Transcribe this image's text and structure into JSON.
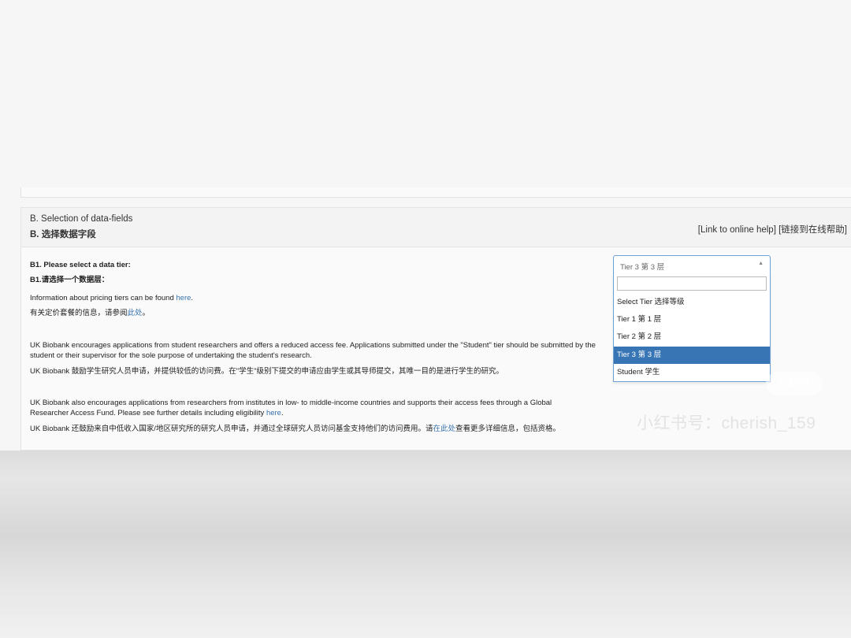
{
  "section": {
    "title_en": "B. Selection of data-fields",
    "title_zh": "B. 选择数据字段",
    "help_link_en": "[Link to online help]",
    "help_link_zh": "[链接到在线帮助]"
  },
  "question": {
    "label_en": "B1. Please select a data tier:",
    "label_zh": "B1.请选择一个数据层：",
    "pricing_en_prefix": "Information about pricing tiers can be found ",
    "pricing_en_link": "here",
    "pricing_en_suffix": ".",
    "pricing_zh_prefix": "有关定价套餐的信息，请参阅",
    "pricing_zh_link": "此处",
    "pricing_zh_suffix": "。",
    "student_en": "UK Biobank encourages applications from student researchers and offers a reduced access fee. Applications submitted under the \"Student\" tier should be submitted by the student or their supervisor for the sole purpose of undertaking the student's research.",
    "student_zh": "UK Biobank 鼓励学生研究人员申请，并提供较低的访问费。在\"学生\"级别下提交的申请应由学生或其导师提交，其唯一目的是进行学生的研究。",
    "lmic_en_prefix": "UK Biobank also encourages applications from researchers from institutes in low- to middle-income countries and supports their access fees through a Global Researcher Access Fund. Please see further details including eligibility ",
    "lmic_en_link": "here",
    "lmic_en_suffix": ".",
    "lmic_zh_prefix": "UK Biobank 还鼓励来自中低收入国家/地区研究所的研究人员申请，并通过全球研究人员访问基金支持他们的访问费用。请",
    "lmic_zh_link": "在此处",
    "lmic_zh_suffix": "查看更多详细信息，包括资格。"
  },
  "tier_select": {
    "selected_value": "Tier 3 第 3 层",
    "search_value": "",
    "options": [
      "Select Tier 选择等级",
      "Tier 1 第 1 层",
      "Tier 2 第 2 层",
      "Tier 3 第 3 层",
      "Student 学生"
    ],
    "highlighted_option": "Tier 3 第 3 层"
  },
  "watermark": {
    "badge": "小红书",
    "text": "小红书号：cherish_159"
  },
  "colors": {
    "link": "#3973ad",
    "highlight": "#3875b5",
    "focus_border": "#6ea0d6"
  }
}
